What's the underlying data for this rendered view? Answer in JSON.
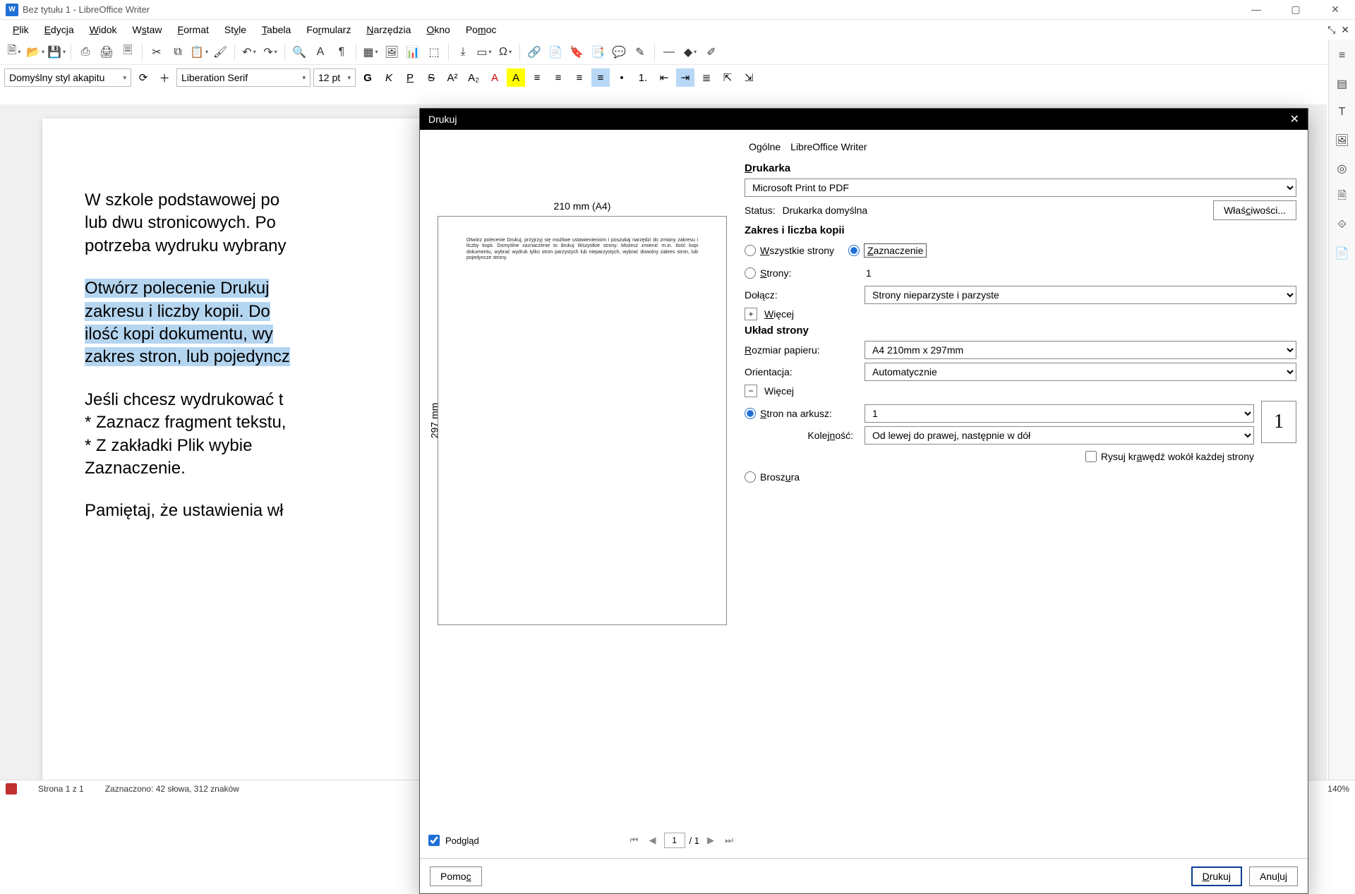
{
  "titlebar": {
    "title": "Bez tytułu 1 - LibreOffice Writer"
  },
  "menubar": {
    "items": [
      "Plik",
      "Edycja",
      "Widok",
      "Wstaw",
      "Format",
      "Style",
      "Tabela",
      "Formularz",
      "Narzędzia",
      "Okno",
      "Pomoc"
    ]
  },
  "fmtbar": {
    "para_style": "Domyślny styl akapitu",
    "font_name": "Liberation Serif",
    "font_size": "12 pt"
  },
  "document": {
    "p1": "W szkole podstawowej po",
    "p1b": "lub dwu stronicowych. Po",
    "p1c": "potrzeba wydruku wybrany",
    "p2a": "Otwórz polecenie Drukuj",
    "p2b": "zakresu i liczby kopii. Do",
    "p2c": "ilość kopi dokumentu, wy",
    "p2d": "zakres stron, lub pojedyncz",
    "p3a": "Jeśli chcesz wydrukować t",
    "p3b": "* Zaznacz fragment tekstu,",
    "p3c": "* Z zakładki Plik wybie",
    "p3d": "Zaznaczenie.",
    "p4": "Pamiętaj, że ustawienia wł"
  },
  "statusbar": {
    "page": "Strona 1 z 1",
    "selection": "Zaznaczono: 42 słowa, 312 znaków",
    "zoom": "140%"
  },
  "dialog": {
    "title": "Drukuj",
    "tabs": {
      "general": "Ogólne",
      "writer": "LibreOffice Writer"
    },
    "printer_section": "Drukarka",
    "printer_name": "Microsoft Print to PDF",
    "status_label": "Status:",
    "status_value": "Drukarka domyślna",
    "properties_btn": "Właściwości...",
    "range_section": "Zakres i liczba kopii",
    "all_pages": "Wszystkie strony",
    "selection": "Zaznaczenie",
    "pages_label": "Strony:",
    "pages_value": "1",
    "include_label": "Dołącz:",
    "include_value": "Strony nieparzyste i parzyste",
    "more1": "Więcej",
    "layout_section": "Układ strony",
    "paper_label": "Rozmiar papieru:",
    "paper_value": "A4 210mm x 297mm",
    "orient_label": "Orientacja:",
    "orient_value": "Automatycznie",
    "more2": "Więcej",
    "pps_label": "Stron na arkusz:",
    "pps_value": "1",
    "order_label": "Kolejność:",
    "order_value": "Od lewej do prawej, następnie w dół",
    "draw_border": "Rysuj krawędź wokół każdej strony",
    "brochure": "Broszura",
    "nup_preview": "1",
    "preview_top": "210 mm (A4)",
    "preview_left": "297 mm",
    "preview_chk": "Podgląd",
    "page_current": "1",
    "page_total": "/ 1",
    "help_btn": "Pomoc",
    "print_btn": "Drukuj",
    "cancel_btn": "Anuluj",
    "mini_text": "Otwórz polecenie Drukuj, przyjrzyj się możliwe ustawienieniom i poszukaj narzędzi do zmiany zakresu i liczby kopii. Domyślne zaznaczenie to drukuj Wszystkie strony. Możesz zmienić m.in. ilość kopi dokumentu, wybrać wydruk tylko stron parzystych lub nieparzystych, wybrać dowolny zakres stron, lub pojedyncze strony."
  }
}
